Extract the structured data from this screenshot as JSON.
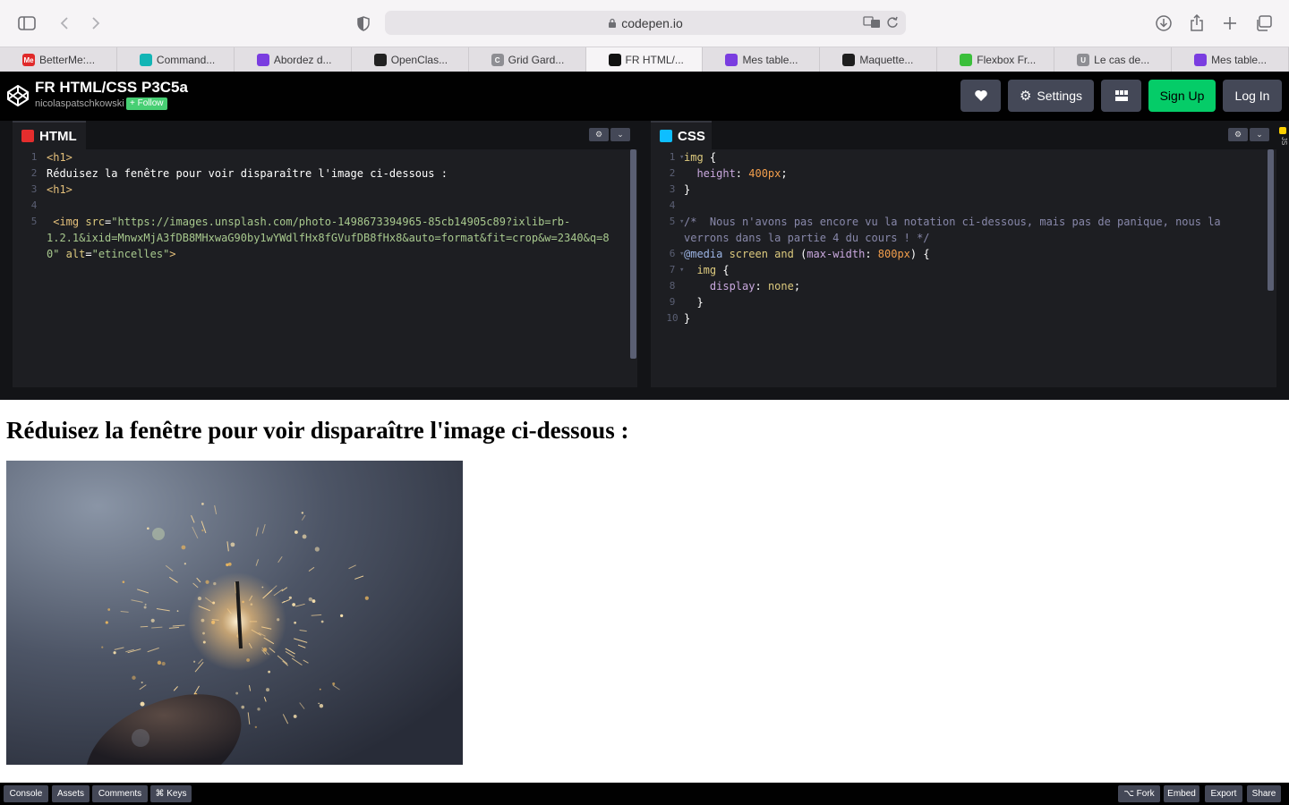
{
  "browser": {
    "address": "codepen.io",
    "tabs": [
      {
        "label": "BetterMe:...",
        "fav_text": "Me",
        "fav_color": "#e02a2a"
      },
      {
        "label": "Command...",
        "fav_text": "",
        "fav_color": "#12b5b5"
      },
      {
        "label": "Abordez d...",
        "fav_text": "",
        "fav_color": "#7a3de0"
      },
      {
        "label": "OpenClas...",
        "fav_text": "",
        "fav_color": "#222"
      },
      {
        "label": "Grid Gard...",
        "fav_text": "C",
        "fav_color": "#8e8e93"
      },
      {
        "label": "FR HTML/...",
        "fav_text": "",
        "fav_color": "#111"
      },
      {
        "label": "Mes table...",
        "fav_text": "",
        "fav_color": "#7a3de0"
      },
      {
        "label": "Maquette...",
        "fav_text": "",
        "fav_color": "#1e1e1e"
      },
      {
        "label": "Flexbox Fr...",
        "fav_text": "",
        "fav_color": "#3bbf3b"
      },
      {
        "label": "Le cas de...",
        "fav_text": "U",
        "fav_color": "#8e8e93"
      },
      {
        "label": "Mes table...",
        "fav_text": "",
        "fav_color": "#7a3de0"
      }
    ]
  },
  "header": {
    "title": "FR HTML/CSS P3C5a",
    "author": "nicolaspatschkowski",
    "follow": "+ Follow",
    "settings": "Settings",
    "signup": "Sign Up",
    "login": "Log In"
  },
  "html_editor": {
    "label": "HTML",
    "lines": [
      {
        "n": "1",
        "parts": [
          {
            "t": "<h1>",
            "c": "c-tag"
          }
        ]
      },
      {
        "n": "2",
        "parts": [
          {
            "t": "Réduisez la fenêtre pour voir disparaître l'image ci-dessous :",
            "c": "c-plain"
          }
        ]
      },
      {
        "n": "3",
        "parts": [
          {
            "t": "<h1>",
            "c": "c-tag"
          }
        ]
      },
      {
        "n": "4",
        "parts": []
      },
      {
        "n": "5",
        "parts": [
          {
            "t": " <img ",
            "c": "c-tag"
          },
          {
            "t": "src",
            "c": "c-attr"
          },
          {
            "t": "=",
            "c": "c-plain"
          },
          {
            "t": "\"https://images.unsplash.com/photo-1498673394965-85cb14905c89?ixlib=rb-",
            "c": "c-str"
          }
        ]
      },
      {
        "n": "",
        "parts": [
          {
            "t": "1.2.1&ixid=MnwxMjA3fDB8MHxwaG90by1wYWdlfHx8fGVufDB8fHx8&auto=format&fit=crop&w=2340&q=8",
            "c": "c-str"
          }
        ]
      },
      {
        "n": "",
        "parts": [
          {
            "t": "0\"",
            "c": "c-str"
          },
          {
            "t": " alt",
            "c": "c-attr"
          },
          {
            "t": "=",
            "c": "c-plain"
          },
          {
            "t": "\"etincelles\"",
            "c": "c-str"
          },
          {
            "t": ">",
            "c": "c-tag"
          }
        ]
      }
    ]
  },
  "css_editor": {
    "label": "CSS",
    "lines": [
      {
        "n": "1",
        "fold": true,
        "parts": [
          {
            "t": "img",
            "c": "c-sel"
          },
          {
            "t": " {",
            "c": "c-plain"
          }
        ]
      },
      {
        "n": "2",
        "parts": [
          {
            "t": "  height",
            "c": "c-prop"
          },
          {
            "t": ": ",
            "c": "c-plain"
          },
          {
            "t": "400px",
            "c": "c-num"
          },
          {
            "t": ";",
            "c": "c-plain"
          }
        ]
      },
      {
        "n": "3",
        "parts": [
          {
            "t": "}",
            "c": "c-plain"
          }
        ]
      },
      {
        "n": "4",
        "parts": []
      },
      {
        "n": "5",
        "fold": true,
        "parts": [
          {
            "t": "/*  Nous n'avons pas encore vu la notation ci-dessous, mais pas de panique, nous la",
            "c": "c-cmt"
          }
        ]
      },
      {
        "n": "",
        "parts": [
          {
            "t": "verrons dans la partie 4 du cours ! */",
            "c": "c-cmt"
          }
        ]
      },
      {
        "n": "6",
        "fold": true,
        "parts": [
          {
            "t": "@media",
            "c": "c-at"
          },
          {
            "t": " screen ",
            "c": "c-kw"
          },
          {
            "t": "and",
            "c": "c-kw"
          },
          {
            "t": " (",
            "c": "c-plain"
          },
          {
            "t": "max-width",
            "c": "c-prop"
          },
          {
            "t": ": ",
            "c": "c-plain"
          },
          {
            "t": "800px",
            "c": "c-num"
          },
          {
            "t": ") {",
            "c": "c-plain"
          }
        ]
      },
      {
        "n": "7",
        "fold": true,
        "parts": [
          {
            "t": "  img",
            "c": "c-sel"
          },
          {
            "t": " {",
            "c": "c-plain"
          }
        ]
      },
      {
        "n": "8",
        "parts": [
          {
            "t": "    display",
            "c": "c-prop"
          },
          {
            "t": ": ",
            "c": "c-plain"
          },
          {
            "t": "none",
            "c": "c-kw"
          },
          {
            "t": ";",
            "c": "c-plain"
          }
        ]
      },
      {
        "n": "9",
        "parts": [
          {
            "t": "  }",
            "c": "c-plain"
          }
        ]
      },
      {
        "n": "10",
        "parts": [
          {
            "t": "}",
            "c": "c-plain"
          }
        ]
      }
    ]
  },
  "js_tab": "JS",
  "preview": {
    "heading": "Réduisez la fenêtre pour voir disparaître l'image ci-dessous :",
    "image_alt": "etincelles"
  },
  "footer": {
    "left": [
      "Console",
      "Assets",
      "Comments",
      "⌘ Keys"
    ],
    "right": [
      "⌥ Fork",
      "Embed",
      "Export",
      "Share"
    ]
  }
}
